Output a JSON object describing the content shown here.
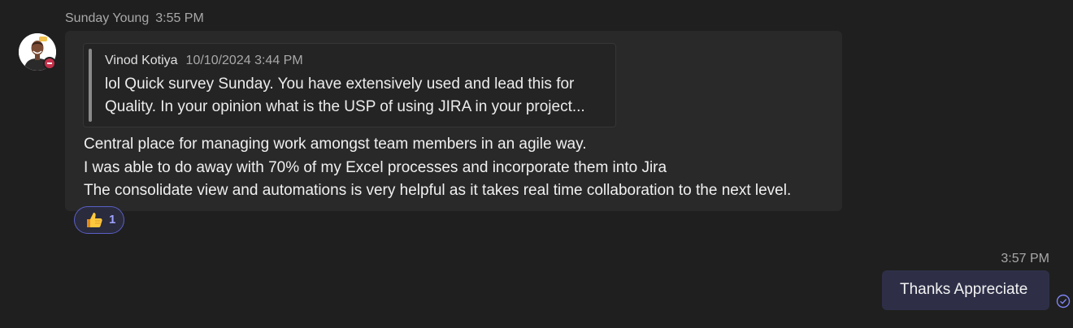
{
  "incoming": {
    "sender": "Sunday Young",
    "time": "3:55 PM",
    "avatar": {
      "icon": "person-avatar",
      "presence": "do-not-disturb",
      "presence_color": "#c4314b"
    },
    "quote": {
      "author": "Vinod Kotiya",
      "timestamp": "10/10/2024 3:44 PM",
      "line1": "lol Quick survey Sunday. You have extensively used and lead this for",
      "line2": "Quality. In your opinion what is the USP of using JIRA in your project..."
    },
    "lines": [
      "Central place for managing work amongst team members in an agile way.",
      "I was able to do away with 70% of my Excel processes and incorporate them into Jira",
      "The consolidate view and automations is very helpful as it takes real time collaboration to the next level."
    ],
    "reaction": {
      "icon": "thumbs-up-icon",
      "count": "1"
    }
  },
  "outgoing": {
    "time": "3:57 PM",
    "text": "Thanks Appreciate",
    "status_icon": "read-receipt-icon"
  },
  "colors": {
    "background": "#1f1f1f",
    "incoming_bubble": "#292929",
    "outgoing_bubble": "#2e2f47",
    "accent": "#5b5fc7"
  }
}
